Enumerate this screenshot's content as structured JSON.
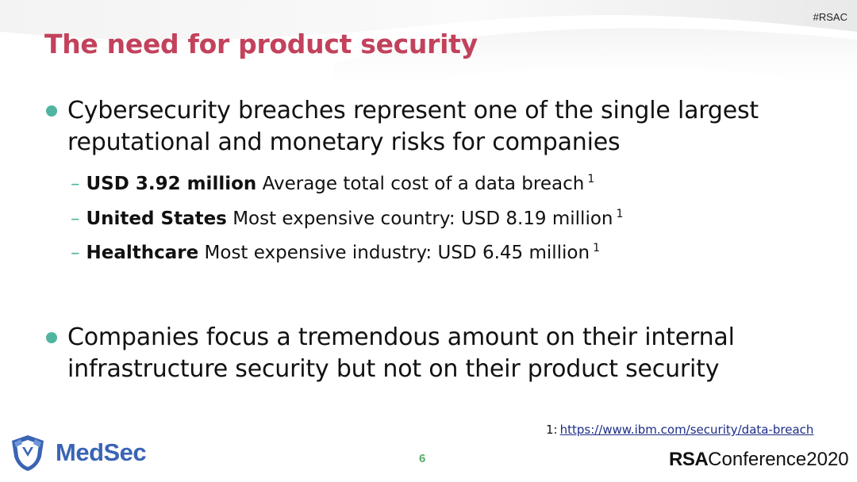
{
  "hashtag": "#RSAC",
  "title": "The need for product security",
  "colors": {
    "title": "#c2425c",
    "bullet": "#50b4a0",
    "page_number": "#55b06a",
    "brand": "#3a64b4",
    "link": "#1c2d86"
  },
  "bullets": [
    {
      "text": "Cybersecurity breaches represent one of the single largest reputational and monetary risks for companies",
      "subitems": [
        {
          "bold": "USD 3.92 million",
          "text": "Average total cost of a data breach",
          "sup": "1"
        },
        {
          "bold": "United States",
          "text": "Most expensive country: USD 8.19 million",
          "sup": "1"
        },
        {
          "bold": "Healthcare",
          "text": "Most expensive industry: USD 6.45 million",
          "sup": "1"
        }
      ]
    },
    {
      "text": "Companies focus a tremendous amount on their internal infrastructure security but not on their product security"
    }
  ],
  "footnote": {
    "marker": "1:",
    "link": "https://www.ibm.com/security/data-breach"
  },
  "footer": {
    "logo_text": "MedSec",
    "logo_icon": "shield-icon",
    "page_number": "6",
    "conference_bold": "RSA",
    "conference_text": "Conference2020"
  }
}
